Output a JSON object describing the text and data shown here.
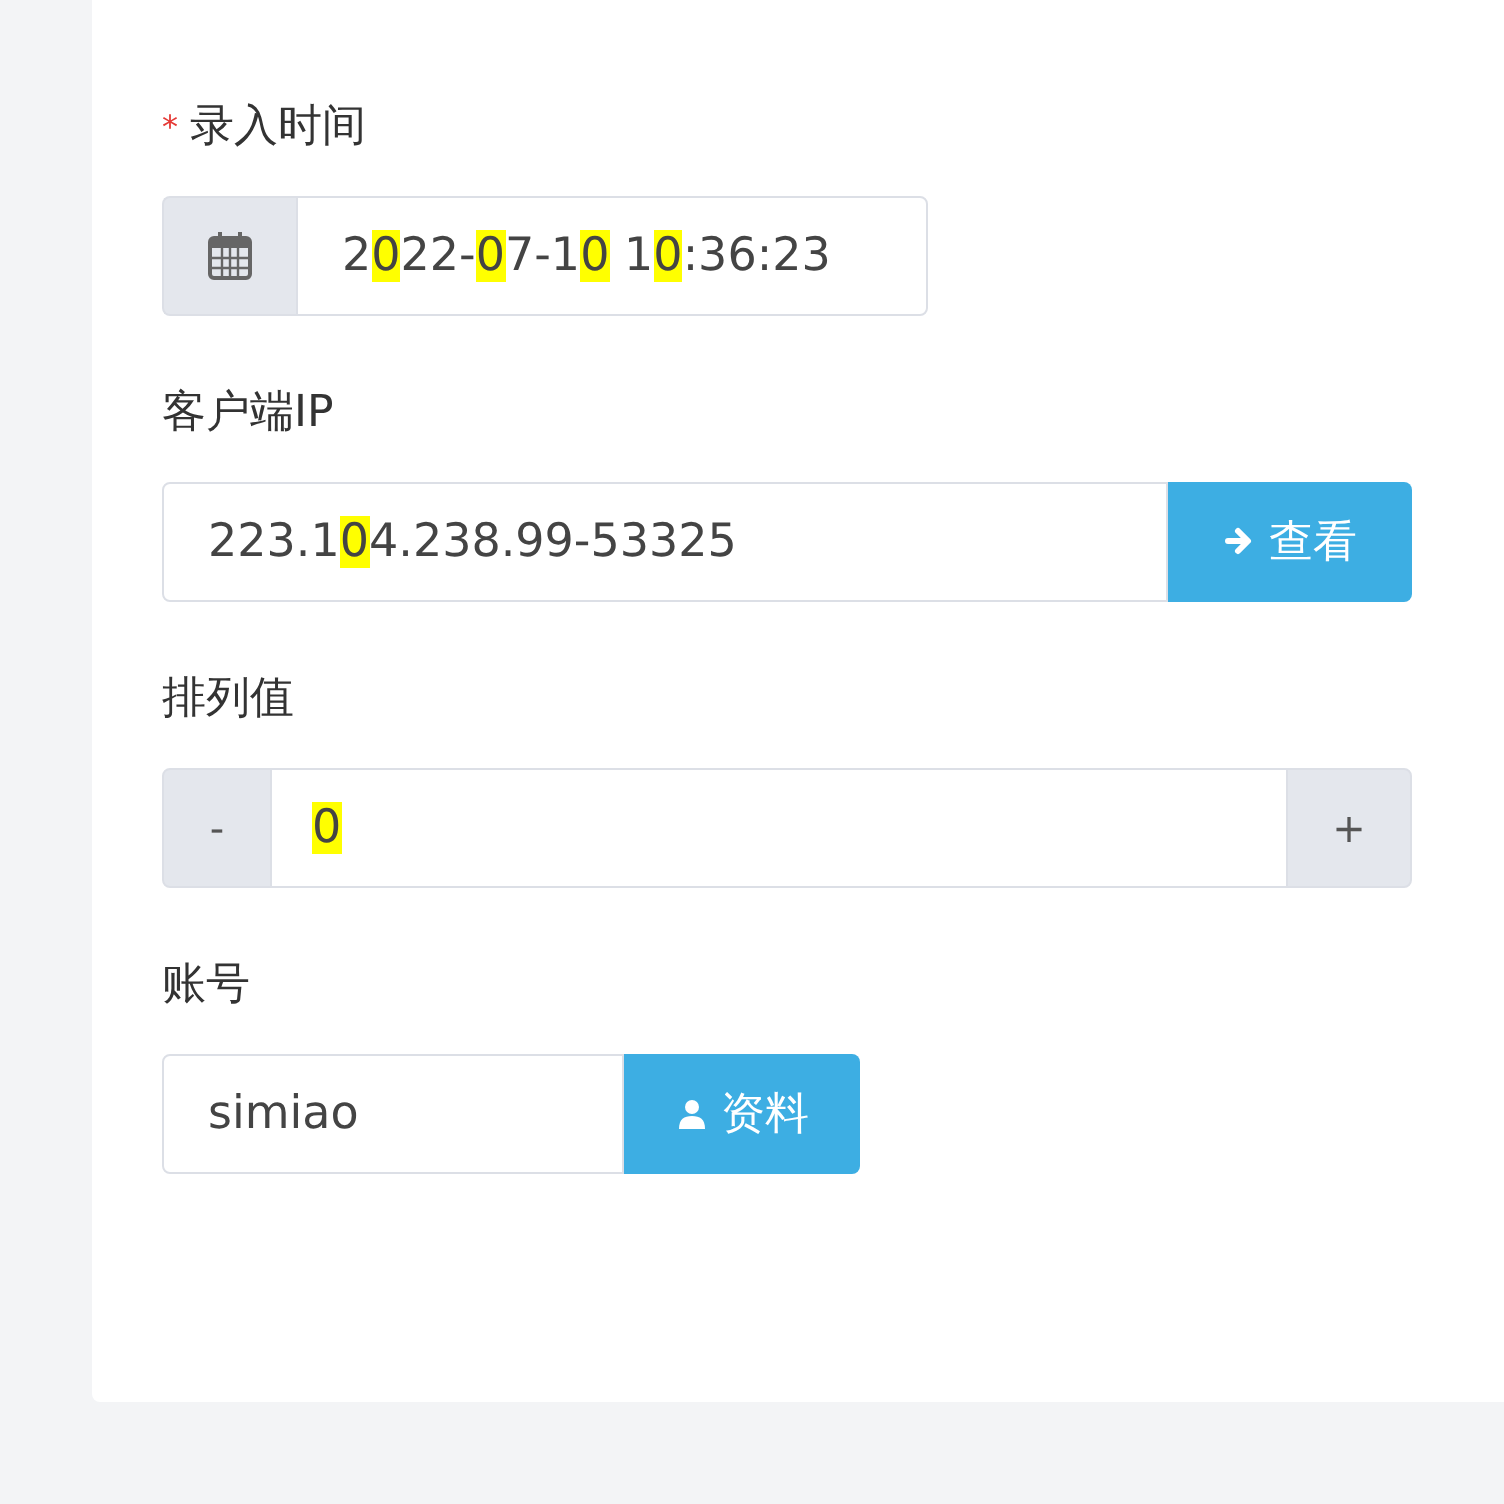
{
  "fields": [
    {
      "kind": "date",
      "label": "录入时间",
      "required_mark": "*",
      "value": [
        {
          "text": "2",
          "highlighted": false
        },
        {
          "text": "0",
          "highlighted": true
        },
        {
          "text": "22-",
          "highlighted": false
        },
        {
          "text": "0",
          "highlighted": true
        },
        {
          "text": "7-1",
          "highlighted": false
        },
        {
          "text": "0",
          "highlighted": true
        },
        {
          "text": " 1",
          "highlighted": false
        },
        {
          "text": "0",
          "highlighted": true
        },
        {
          "text": ":36:23",
          "highlighted": false
        }
      ]
    },
    {
      "kind": "button",
      "label": "客户端IP",
      "value": [
        {
          "text": "223.1",
          "highlighted": false
        },
        {
          "text": "0",
          "highlighted": true
        },
        {
          "text": "4.238.99-53325",
          "highlighted": false
        }
      ],
      "button": {
        "kind": "arrow",
        "label": "查看"
      }
    },
    {
      "kind": "stepper",
      "label": "排列值",
      "value": [
        {
          "text": "0",
          "highlighted": true
        }
      ],
      "minus": "-",
      "plus": "+"
    },
    {
      "kind": "button",
      "label": "账号",
      "value": [
        {
          "text": "simiao",
          "highlighted": false
        }
      ],
      "button": {
        "kind": "user",
        "label": "资料"
      }
    }
  ]
}
